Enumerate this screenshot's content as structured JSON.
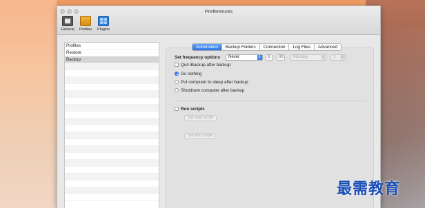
{
  "window": {
    "title": "Preferences"
  },
  "toolbar": [
    {
      "label": "General",
      "icon": "general-icon"
    },
    {
      "label": "Profiles",
      "icon": "profiles-icon"
    },
    {
      "label": "Plugins",
      "icon": "plugins-icon"
    }
  ],
  "sidebar": {
    "items": [
      "Profiles",
      "Restore",
      "Backup"
    ],
    "selected": "Backup"
  },
  "tabs": [
    "Automation",
    "Backup Folders",
    "Connection",
    "Log Files",
    "Advanced"
  ],
  "active_tab": "Automation",
  "automation": {
    "frequency_label": "Set frequency options",
    "frequency_value": "Never",
    "hour": "0",
    "minute": "00",
    "weekday": "Monday",
    "day": "1",
    "quit_label": "Quit iBackup after backup",
    "radio_options": [
      "Do nothing",
      "Put computer to sleep after backup",
      "Shutdown computer after backup"
    ],
    "selected_radio": "Do nothing",
    "run_scripts_label": "Run scripts",
    "set_start_script": "Set start script",
    "set_end_script": "Set end script"
  },
  "watermark": "最需教育"
}
